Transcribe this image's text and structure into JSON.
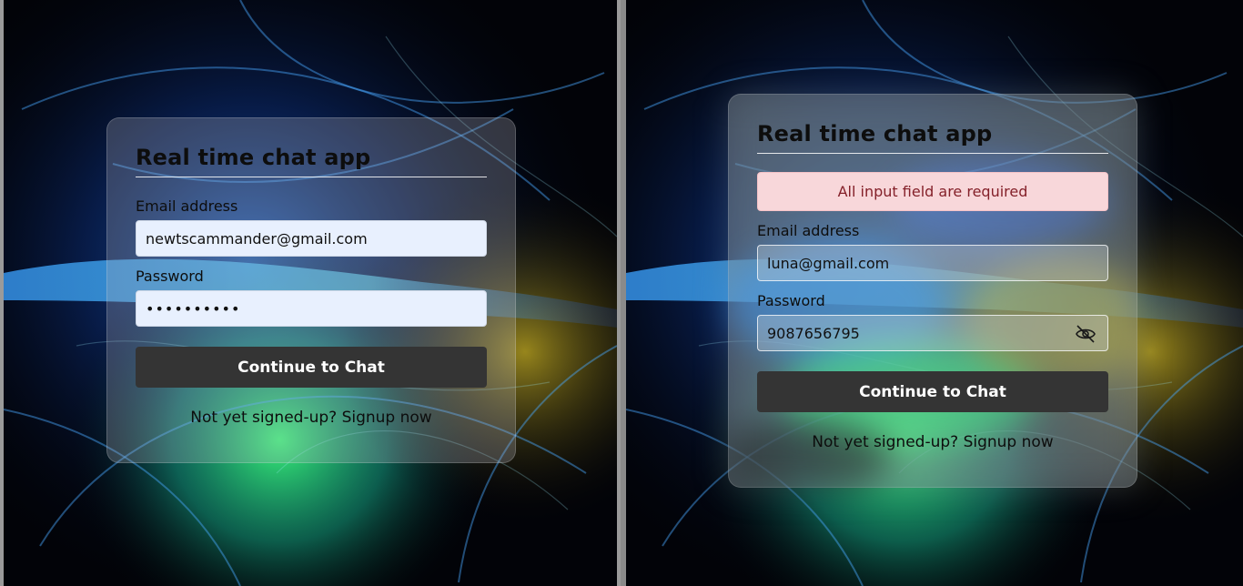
{
  "left_panel": {
    "title": "Real time chat app",
    "email_label": "Email address",
    "email_value": "newtscammander@gmail.com",
    "password_label": "Password",
    "password_masked": "••••••••••",
    "continue_label": "Continue to Chat",
    "signup_text": "Not yet signed-up? Signup now"
  },
  "right_panel": {
    "title": "Real time chat app",
    "alert_text": "All input field are required",
    "email_label": "Email address",
    "email_value": "luna@gmail.com",
    "password_label": "Password",
    "password_value": "9087656795",
    "toggle_icon": "eye-off-icon",
    "continue_label": "Continue to Chat",
    "signup_text": "Not yet signed-up? Signup now"
  },
  "colors": {
    "button": "#343434",
    "alert_bg": "#f8d7da",
    "alert_text": "#842029",
    "autofill_bg": "#e8f0fe"
  }
}
